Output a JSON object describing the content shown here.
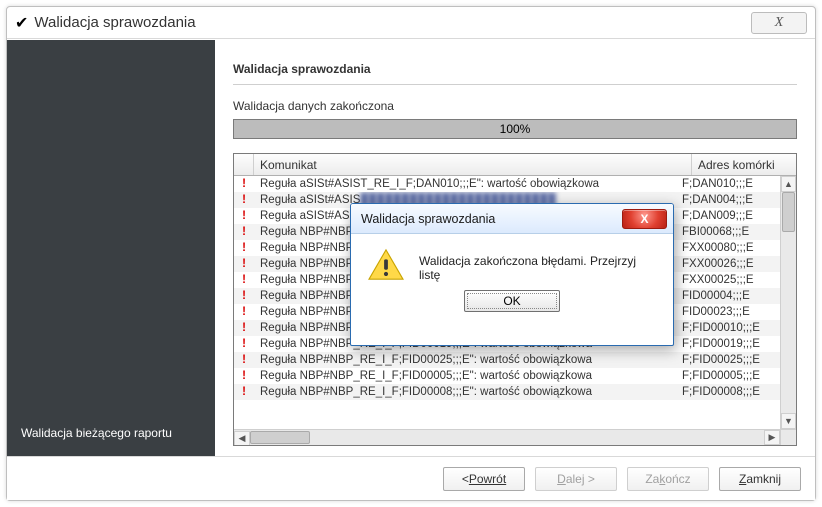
{
  "window": {
    "title": "Walidacja sprawozdania",
    "close_glyph": "X"
  },
  "sidebar": {
    "status": "Walidacja bieżącego raportu"
  },
  "main": {
    "heading": "Walidacja sprawozdania",
    "status_text": "Walidacja danych zakończona",
    "progress": "100%"
  },
  "table": {
    "columns": {
      "message": "Komunikat",
      "address": "Adres komórki"
    },
    "rows": [
      {
        "msg": "Reguła aSISt#ASIST_RE_I_F;DAN010;;;E\": wartość obowiązkowa",
        "addr": "F;DAN010;;;E",
        "blur": false
      },
      {
        "msg": "Reguła aSISt#ASIS",
        "addr": "F;DAN004;;;E",
        "blur": true
      },
      {
        "msg": "Reguła aSISt#ASIS",
        "addr": "F;DAN009;;;E",
        "blur": true
      },
      {
        "msg": "Reguła NBP#NBP",
        "addr": "FBI00068;;;E",
        "blur": true
      },
      {
        "msg": "Reguła NBP#NBP",
        "addr": "FXX00080;;;E",
        "blur": true
      },
      {
        "msg": "Reguła NBP#NBP",
        "addr": "FXX00026;;;E",
        "blur": true
      },
      {
        "msg": "Reguła NBP#NBP",
        "addr": "FXX00025;;;E",
        "blur": true
      },
      {
        "msg": "Reguła NBP#NBP",
        "addr": "FID00004;;;E",
        "blur": true
      },
      {
        "msg": "Reguła NBP#NBP",
        "addr": "FID00023;;;E",
        "blur": true
      },
      {
        "msg": "Reguła NBP#NBP_RE_I_F;FID00010;;;E\": wartość obowiązkowa",
        "addr": "F;FID00010;;;E",
        "blur": false
      },
      {
        "msg": "Reguła NBP#NBP_RE_I_F;FID00019;;;E\": wartość obowiązkowa",
        "addr": "F;FID00019;;;E",
        "blur": false
      },
      {
        "msg": "Reguła NBP#NBP_RE_I_F;FID00025;;;E\": wartość obowiązkowa",
        "addr": "F;FID00025;;;E",
        "blur": false
      },
      {
        "msg": "Reguła NBP#NBP_RE_I_F;FID00005;;;E\": wartość obowiązkowa",
        "addr": "F;FID00005;;;E",
        "blur": false
      },
      {
        "msg": "Reguła NBP#NBP_RE_I_F;FID00008;;;E\": wartość obowiązkowa",
        "addr": "F;FID00008;;;E",
        "blur": false
      }
    ]
  },
  "footer": {
    "back": "Powrót",
    "next": "Dalej >",
    "finish": "Zakończ",
    "close": "Zamknij"
  },
  "modal": {
    "title": "Walidacja sprawozdania",
    "message": "Walidacja zakończona błędami. Przejrzyj listę",
    "ok": "OK"
  }
}
